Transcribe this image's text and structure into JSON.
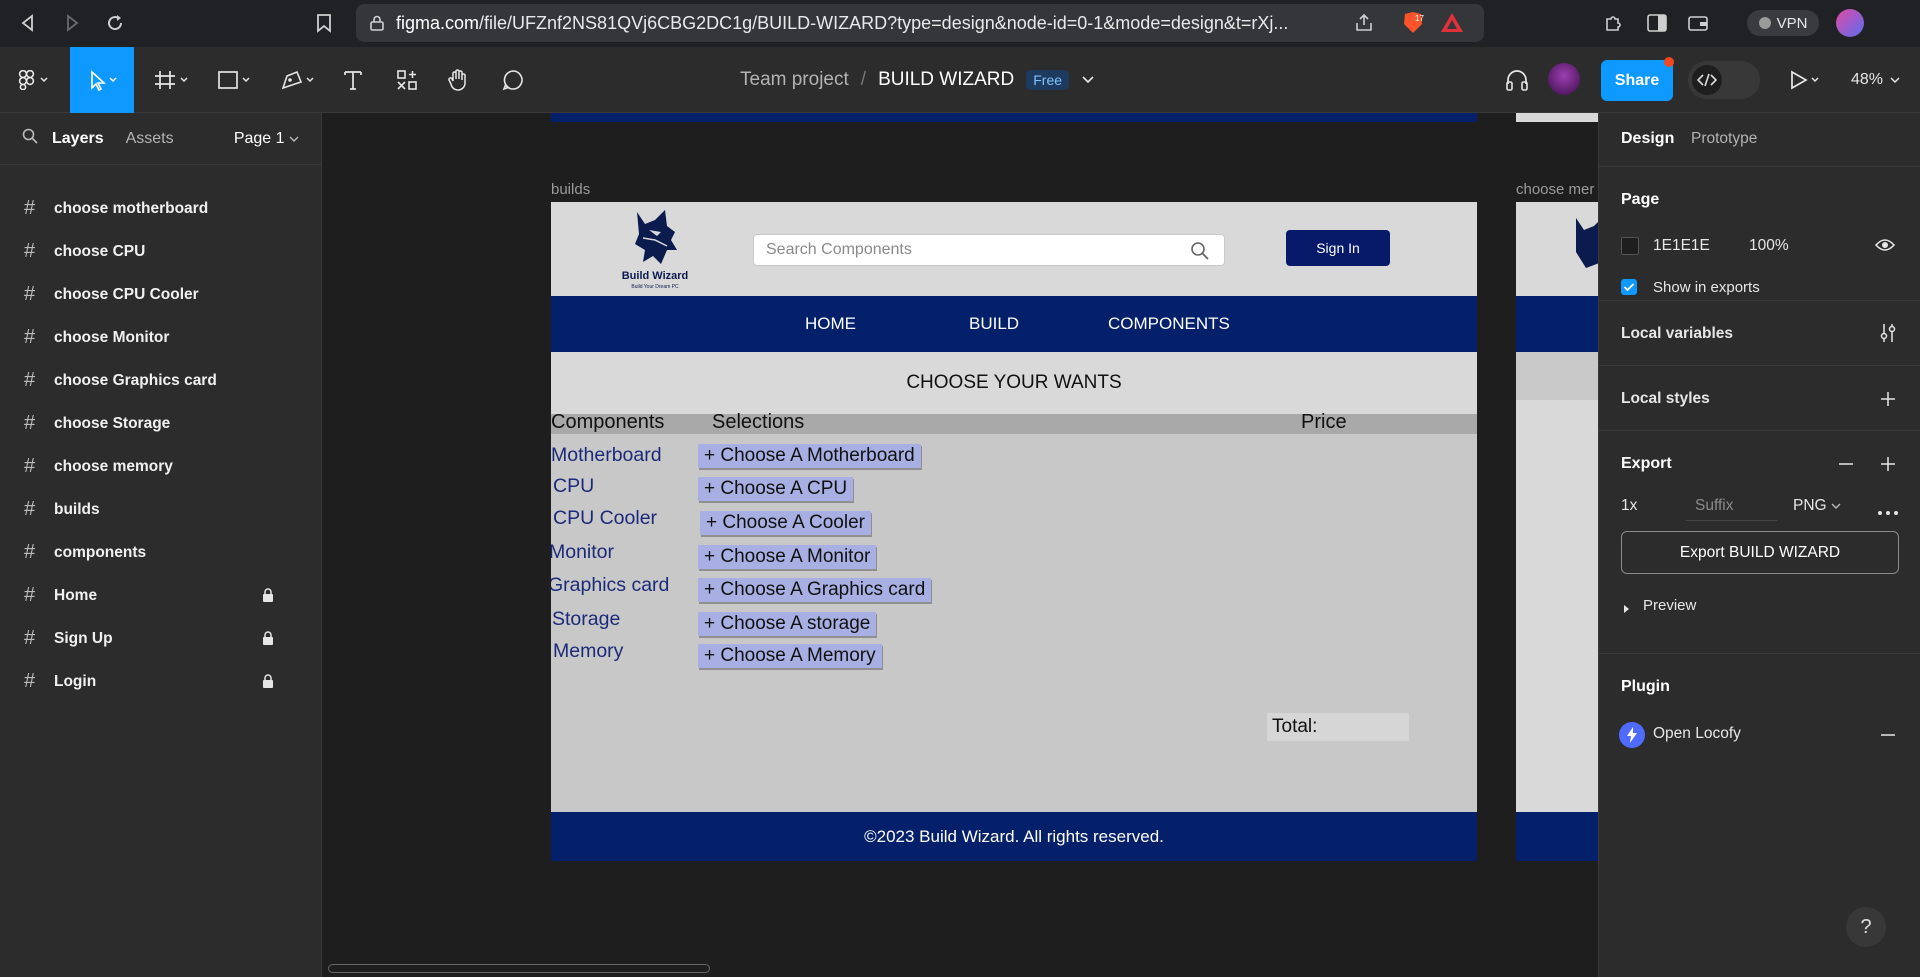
{
  "browser": {
    "url_host": "figma.com",
    "url_path": "/file/UFZnf2NS81QVj6CBG2DC1g/BUILD-WIZARD?type=design&node-id=0-1&mode=design&t=rXj...",
    "brave_count": "17",
    "vpn_label": "VPN"
  },
  "toolbar": {
    "team": "Team project",
    "separator": "/",
    "file_name": "BUILD WIZARD",
    "plan_badge": "Free",
    "share_label": "Share",
    "zoom": "48%"
  },
  "left_panel": {
    "tab_layers": "Layers",
    "tab_assets": "Assets",
    "page_label": "Page 1",
    "layers": [
      {
        "name": "choose motherboard",
        "locked": false
      },
      {
        "name": "choose CPU",
        "locked": false
      },
      {
        "name": "choose CPU Cooler",
        "locked": false
      },
      {
        "name": "choose Monitor",
        "locked": false
      },
      {
        "name": "choose Graphics card",
        "locked": false
      },
      {
        "name": "choose Storage",
        "locked": false
      },
      {
        "name": "choose memory",
        "locked": false
      },
      {
        "name": "builds",
        "locked": false
      },
      {
        "name": "components",
        "locked": false
      },
      {
        "name": "Home",
        "locked": true
      },
      {
        "name": "Sign Up",
        "locked": true
      },
      {
        "name": "Login",
        "locked": true
      }
    ]
  },
  "canvas": {
    "frame_label": "builds",
    "peek_label": "choose mer",
    "site": {
      "logo_name": "Build Wizard",
      "logo_tagline": "Build Your Dream PC",
      "search_placeholder": "Search Components",
      "signin_label": "Sign In",
      "nav": [
        "HOME",
        "BUILD",
        "COMPONENTS"
      ],
      "section_title": "CHOOSE YOUR WANTS",
      "columns": [
        "Components",
        "Selections",
        "Price"
      ],
      "rows": [
        {
          "component": "Motherboard",
          "action": "+ Choose A Motherboard"
        },
        {
          "component": "CPU",
          "action": "+ Choose A CPU"
        },
        {
          "component": "CPU Cooler",
          "action": "+ Choose A Cooler"
        },
        {
          "component": "Monitor",
          "action": "+ Choose A Monitor"
        },
        {
          "component": "Graphics card",
          "action": "+ Choose A Graphics card"
        },
        {
          "component": "Storage",
          "action": "+ Choose A storage"
        },
        {
          "component": "Memory",
          "action": "+ Choose A Memory"
        }
      ],
      "total_label": "Total:",
      "footer": "©2023 Build Wizard. All rights reserved."
    }
  },
  "right_panel": {
    "tab_design": "Design",
    "tab_prototype": "Prototype",
    "page_title": "Page",
    "page_color": "1E1E1E",
    "page_opacity": "100%",
    "show_in_exports": "Show in exports",
    "local_variables": "Local variables",
    "local_styles": "Local styles",
    "export_title": "Export",
    "export_scale": "1x",
    "export_suffix_placeholder": "Suffix",
    "export_format": "PNG",
    "export_button": "Export BUILD WIZARD",
    "preview": "Preview",
    "plugin_title": "Plugin",
    "plugin_name": "Open Locofy"
  },
  "colors": {
    "accent": "#0d99ff",
    "site_navy": "#05206b",
    "choose_button": "#a8b0e3"
  }
}
